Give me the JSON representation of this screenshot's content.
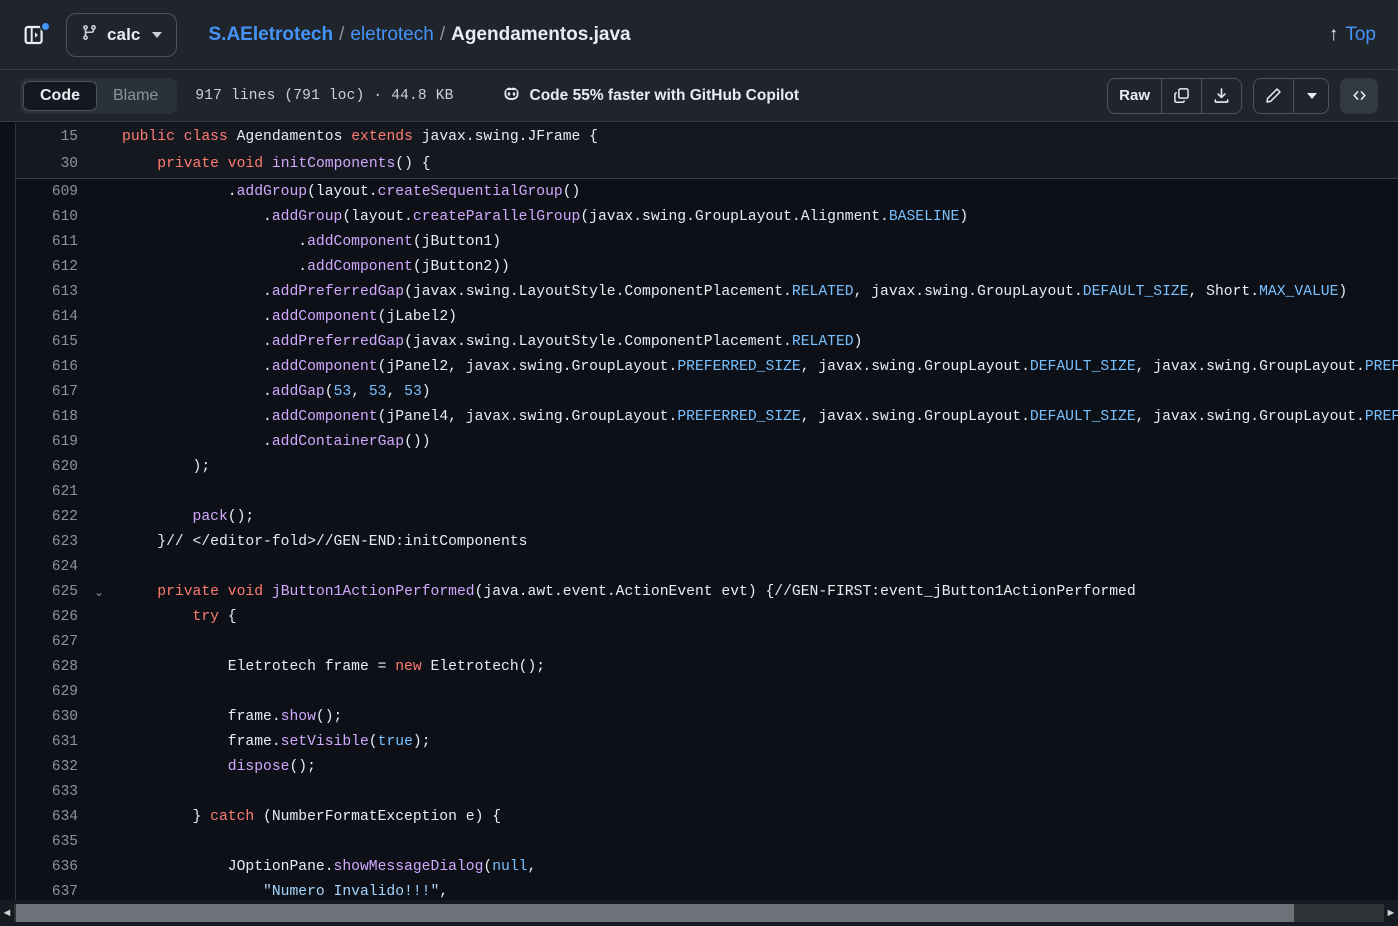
{
  "header": {
    "sidebar_toggle_icon": "sidebar-expand-icon",
    "has_notification_dot": true,
    "branch": {
      "icon": "branch-icon",
      "name": "calc"
    },
    "breadcrumb": {
      "owner": "S.AEletrotech",
      "sep1": "/",
      "repo": "eletrotech",
      "sep2": "/",
      "file": "Agendamentos.java"
    },
    "top_link": {
      "icon": "arrow-up-icon",
      "arrow": "↑",
      "label": "Top"
    }
  },
  "toolbar": {
    "tabs": [
      {
        "label": "Code",
        "active": true
      },
      {
        "label": "Blame",
        "active": false
      }
    ],
    "file_meta": "917 lines (791 loc) · 44.8 KB",
    "copilot": {
      "icon": "copilot-icon",
      "label": "Code 55% faster with GitHub Copilot"
    },
    "actions": {
      "raw_label": "Raw",
      "copy_icon": "copy-icon",
      "download_icon": "download-icon",
      "edit_icon": "pencil-icon",
      "edit_caret_icon": "chevron-down-icon",
      "symbols_icon": "code-brackets-icon"
    }
  },
  "colors": {
    "background": "#0d1117",
    "chrome": "#20252c",
    "accent_blue": "#4493f8",
    "keyword": "#ff7b72",
    "function": "#d2a8ff",
    "constant": "#79c0ff",
    "string": "#a5d6ff",
    "text": "#e6edf3",
    "muted": "#8b949e"
  },
  "sticky_lines": [
    {
      "number": "15",
      "fold": "",
      "tokens": [
        {
          "t": "public",
          "c": "kw"
        },
        {
          "t": " ",
          "c": "plain"
        },
        {
          "t": "class",
          "c": "kw"
        },
        {
          "t": " Agendamentos ",
          "c": "plain"
        },
        {
          "t": "extends",
          "c": "kw"
        },
        {
          "t": " javax.swing.JFrame {",
          "c": "plain"
        }
      ]
    },
    {
      "number": "30",
      "fold": "",
      "tokens": [
        {
          "t": "    ",
          "c": "plain"
        },
        {
          "t": "private",
          "c": "kw"
        },
        {
          "t": " ",
          "c": "plain"
        },
        {
          "t": "void",
          "c": "kw"
        },
        {
          "t": " ",
          "c": "plain"
        },
        {
          "t": "initComponents",
          "c": "fn"
        },
        {
          "t": "() {",
          "c": "plain"
        }
      ]
    }
  ],
  "code_lines": [
    {
      "number": "609",
      "fold": "",
      "tokens": [
        {
          "t": "            .",
          "c": "plain"
        },
        {
          "t": "addGroup",
          "c": "fn"
        },
        {
          "t": "(layout.",
          "c": "plain"
        },
        {
          "t": "createSequentialGroup",
          "c": "fn"
        },
        {
          "t": "()",
          "c": "plain"
        }
      ]
    },
    {
      "number": "610",
      "fold": "",
      "tokens": [
        {
          "t": "                .",
          "c": "plain"
        },
        {
          "t": "addGroup",
          "c": "fn"
        },
        {
          "t": "(layout.",
          "c": "plain"
        },
        {
          "t": "createParallelGroup",
          "c": "fn"
        },
        {
          "t": "(javax.swing.GroupLayout.Alignment.",
          "c": "plain"
        },
        {
          "t": "BASELINE",
          "c": "cst"
        },
        {
          "t": ")",
          "c": "plain"
        }
      ]
    },
    {
      "number": "611",
      "fold": "",
      "tokens": [
        {
          "t": "                    .",
          "c": "plain"
        },
        {
          "t": "addComponent",
          "c": "fn"
        },
        {
          "t": "(jButton1)",
          "c": "plain"
        }
      ]
    },
    {
      "number": "612",
      "fold": "",
      "tokens": [
        {
          "t": "                    .",
          "c": "plain"
        },
        {
          "t": "addComponent",
          "c": "fn"
        },
        {
          "t": "(jButton2))",
          "c": "plain"
        }
      ]
    },
    {
      "number": "613",
      "fold": "",
      "tokens": [
        {
          "t": "                .",
          "c": "plain"
        },
        {
          "t": "addPreferredGap",
          "c": "fn"
        },
        {
          "t": "(javax.swing.LayoutStyle.ComponentPlacement.",
          "c": "plain"
        },
        {
          "t": "RELATED",
          "c": "cst"
        },
        {
          "t": ", javax.swing.GroupLayout.",
          "c": "plain"
        },
        {
          "t": "DEFAULT_SIZE",
          "c": "cst"
        },
        {
          "t": ", Short.",
          "c": "plain"
        },
        {
          "t": "MAX_VALUE",
          "c": "cst"
        },
        {
          "t": ")",
          "c": "plain"
        }
      ]
    },
    {
      "number": "614",
      "fold": "",
      "tokens": [
        {
          "t": "                .",
          "c": "plain"
        },
        {
          "t": "addComponent",
          "c": "fn"
        },
        {
          "t": "(jLabel2)",
          "c": "plain"
        }
      ]
    },
    {
      "number": "615",
      "fold": "",
      "tokens": [
        {
          "t": "                .",
          "c": "plain"
        },
        {
          "t": "addPreferredGap",
          "c": "fn"
        },
        {
          "t": "(javax.swing.LayoutStyle.ComponentPlacement.",
          "c": "plain"
        },
        {
          "t": "RELATED",
          "c": "cst"
        },
        {
          "t": ")",
          "c": "plain"
        }
      ]
    },
    {
      "number": "616",
      "fold": "",
      "tokens": [
        {
          "t": "                .",
          "c": "plain"
        },
        {
          "t": "addComponent",
          "c": "fn"
        },
        {
          "t": "(jPanel2, javax.swing.GroupLayout.",
          "c": "plain"
        },
        {
          "t": "PREFERRED_SIZE",
          "c": "cst"
        },
        {
          "t": ", javax.swing.GroupLayout.",
          "c": "plain"
        },
        {
          "t": "DEFAULT_SIZE",
          "c": "cst"
        },
        {
          "t": ", javax.swing.GroupLayout.",
          "c": "plain"
        },
        {
          "t": "PREFERRED_SIZE",
          "c": "cst"
        },
        {
          "t": ")",
          "c": "plain"
        }
      ]
    },
    {
      "number": "617",
      "fold": "",
      "tokens": [
        {
          "t": "                .",
          "c": "plain"
        },
        {
          "t": "addGap",
          "c": "fn"
        },
        {
          "t": "(",
          "c": "plain"
        },
        {
          "t": "53",
          "c": "num"
        },
        {
          "t": ", ",
          "c": "plain"
        },
        {
          "t": "53",
          "c": "num"
        },
        {
          "t": ", ",
          "c": "plain"
        },
        {
          "t": "53",
          "c": "num"
        },
        {
          "t": ")",
          "c": "plain"
        }
      ]
    },
    {
      "number": "618",
      "fold": "",
      "tokens": [
        {
          "t": "                .",
          "c": "plain"
        },
        {
          "t": "addComponent",
          "c": "fn"
        },
        {
          "t": "(jPanel4, javax.swing.GroupLayout.",
          "c": "plain"
        },
        {
          "t": "PREFERRED_SIZE",
          "c": "cst"
        },
        {
          "t": ", javax.swing.GroupLayout.",
          "c": "plain"
        },
        {
          "t": "DEFAULT_SIZE",
          "c": "cst"
        },
        {
          "t": ", javax.swing.GroupLayout.",
          "c": "plain"
        },
        {
          "t": "PREFERRED_SIZE",
          "c": "cst"
        },
        {
          "t": ")",
          "c": "plain"
        }
      ]
    },
    {
      "number": "619",
      "fold": "",
      "tokens": [
        {
          "t": "                .",
          "c": "plain"
        },
        {
          "t": "addContainerGap",
          "c": "fn"
        },
        {
          "t": "())",
          "c": "plain"
        }
      ]
    },
    {
      "number": "620",
      "fold": "",
      "tokens": [
        {
          "t": "        );",
          "c": "plain"
        }
      ]
    },
    {
      "number": "621",
      "fold": "",
      "tokens": [
        {
          "t": "",
          "c": "plain"
        }
      ]
    },
    {
      "number": "622",
      "fold": "",
      "tokens": [
        {
          "t": "        ",
          "c": "plain"
        },
        {
          "t": "pack",
          "c": "fn"
        },
        {
          "t": "();",
          "c": "plain"
        }
      ]
    },
    {
      "number": "623",
      "fold": "",
      "tokens": [
        {
          "t": "    }// </editor-fold>//GEN-END:initComponents",
          "c": "plain"
        }
      ]
    },
    {
      "number": "624",
      "fold": "",
      "tokens": [
        {
          "t": "",
          "c": "plain"
        }
      ]
    },
    {
      "number": "625",
      "fold": "⌄",
      "tokens": [
        {
          "t": "    ",
          "c": "plain"
        },
        {
          "t": "private",
          "c": "kw"
        },
        {
          "t": " ",
          "c": "plain"
        },
        {
          "t": "void",
          "c": "kw"
        },
        {
          "t": " ",
          "c": "plain"
        },
        {
          "t": "jButton1ActionPerformed",
          "c": "fn"
        },
        {
          "t": "(java.awt.event.ActionEvent evt) {//GEN-FIRST:event_jButton1ActionPerformed",
          "c": "plain"
        }
      ]
    },
    {
      "number": "626",
      "fold": "",
      "tokens": [
        {
          "t": "        ",
          "c": "plain"
        },
        {
          "t": "try",
          "c": "kw"
        },
        {
          "t": " {",
          "c": "plain"
        }
      ]
    },
    {
      "number": "627",
      "fold": "",
      "tokens": [
        {
          "t": "",
          "c": "plain"
        }
      ]
    },
    {
      "number": "628",
      "fold": "",
      "tokens": [
        {
          "t": "            Eletrotech frame = ",
          "c": "plain"
        },
        {
          "t": "new",
          "c": "kw"
        },
        {
          "t": " Eletrotech();",
          "c": "plain"
        }
      ]
    },
    {
      "number": "629",
      "fold": "",
      "tokens": [
        {
          "t": "",
          "c": "plain"
        }
      ]
    },
    {
      "number": "630",
      "fold": "",
      "tokens": [
        {
          "t": "            frame.",
          "c": "plain"
        },
        {
          "t": "show",
          "c": "fn"
        },
        {
          "t": "();",
          "c": "plain"
        }
      ]
    },
    {
      "number": "631",
      "fold": "",
      "tokens": [
        {
          "t": "            frame.",
          "c": "plain"
        },
        {
          "t": "setVisible",
          "c": "fn"
        },
        {
          "t": "(",
          "c": "plain"
        },
        {
          "t": "true",
          "c": "cst"
        },
        {
          "t": ");",
          "c": "plain"
        }
      ]
    },
    {
      "number": "632",
      "fold": "",
      "tokens": [
        {
          "t": "            ",
          "c": "plain"
        },
        {
          "t": "dispose",
          "c": "fn"
        },
        {
          "t": "();",
          "c": "plain"
        }
      ]
    },
    {
      "number": "633",
      "fold": "",
      "tokens": [
        {
          "t": "",
          "c": "plain"
        }
      ]
    },
    {
      "number": "634",
      "fold": "",
      "tokens": [
        {
          "t": "        } ",
          "c": "plain"
        },
        {
          "t": "catch",
          "c": "kw"
        },
        {
          "t": " (NumberFormatException e) {",
          "c": "plain"
        }
      ]
    },
    {
      "number": "635",
      "fold": "",
      "tokens": [
        {
          "t": "",
          "c": "plain"
        }
      ]
    },
    {
      "number": "636",
      "fold": "",
      "tokens": [
        {
          "t": "            JOptionPane.",
          "c": "plain"
        },
        {
          "t": "showMessageDialog",
          "c": "fn"
        },
        {
          "t": "(",
          "c": "plain"
        },
        {
          "t": "null",
          "c": "cst"
        },
        {
          "t": ",",
          "c": "plain"
        }
      ]
    },
    {
      "number": "637",
      "fold": "",
      "tokens": [
        {
          "t": "                ",
          "c": "plain"
        },
        {
          "t": "\"Numero Invalido!!!\"",
          "c": "str"
        },
        {
          "t": ",",
          "c": "plain"
        }
      ]
    }
  ],
  "scrollbar": {
    "left_arrow": "◄",
    "right_arrow": "►"
  }
}
